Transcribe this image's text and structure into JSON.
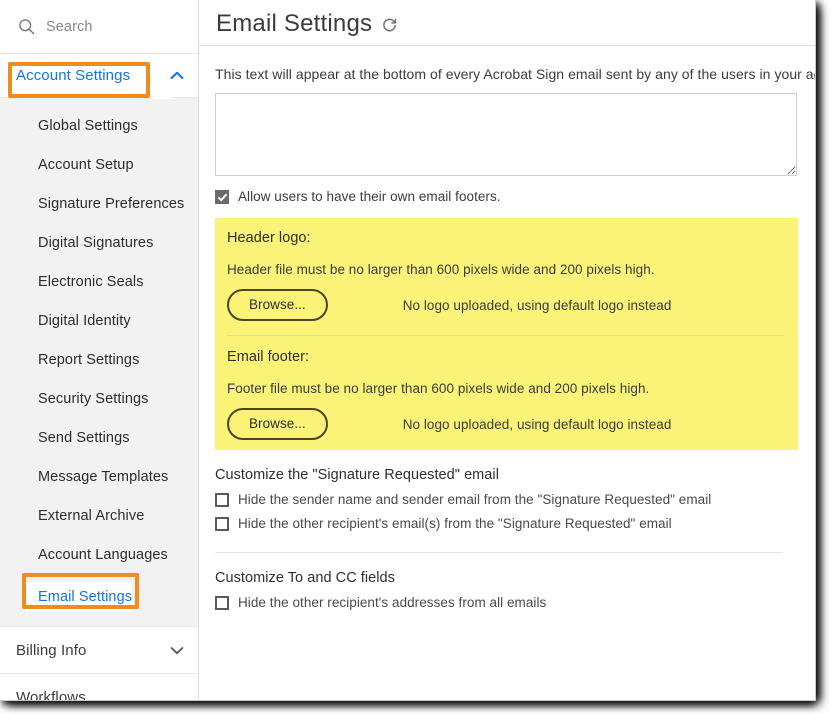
{
  "sidebar": {
    "search": {
      "placeholder": "Search",
      "icon": "search-icon"
    },
    "account_settings": {
      "label": "Account Settings",
      "chevron": "chevron-up-icon",
      "expanded": true,
      "highlight_color": "#f08b1d",
      "link_color": "#1473e6"
    },
    "items": [
      {
        "label": "Global Settings",
        "selected": false
      },
      {
        "label": "Account Setup",
        "selected": false
      },
      {
        "label": "Signature Preferences",
        "selected": false
      },
      {
        "label": "Digital Signatures",
        "selected": false
      },
      {
        "label": "Electronic Seals",
        "selected": false
      },
      {
        "label": "Digital Identity",
        "selected": false
      },
      {
        "label": "Report Settings",
        "selected": false
      },
      {
        "label": "Security Settings",
        "selected": false
      },
      {
        "label": "Send Settings",
        "selected": false
      },
      {
        "label": "Message Templates",
        "selected": false
      },
      {
        "label": "External Archive",
        "selected": false
      },
      {
        "label": "Account Languages",
        "selected": false
      },
      {
        "label": "Email Settings",
        "selected": true
      }
    ],
    "billing_info": {
      "label": "Billing Info",
      "chevron": "chevron-down-icon"
    },
    "workflows": {
      "label": "Workflows"
    }
  },
  "main": {
    "title": "Email Settings",
    "refresh_icon": "refresh-icon",
    "intro_text": "This text will appear at the bottom of every Acrobat Sign email sent by any of the users in your account.",
    "footer_textarea_value": "",
    "allow_own_footers": {
      "label": "Allow users to have their own email footers.",
      "checked": true
    },
    "highlight": {
      "background": "#faf378",
      "header_logo": {
        "heading": "Header logo:",
        "description": "Header file must be no larger than 600 pixels wide and 200 pixels high.",
        "browse_label": "Browse...",
        "status": "No logo uploaded, using default logo instead"
      },
      "email_footer": {
        "heading": "Email footer:",
        "description": "Footer file must be no larger than 600 pixels wide and 200 pixels high.",
        "browse_label": "Browse...",
        "status": "No logo uploaded, using default logo instead"
      }
    },
    "signature_requested": {
      "title": "Customize the \"Signature Requested\" email",
      "options": [
        {
          "label": "Hide the sender name and sender email from the \"Signature Requested\" email",
          "checked": false
        },
        {
          "label": "Hide the other recipient's email(s) from the \"Signature Requested\" email",
          "checked": false
        }
      ]
    },
    "to_cc_fields": {
      "title": "Customize To and CC fields",
      "options": [
        {
          "label": "Hide the other recipient's addresses from all emails",
          "checked": false
        }
      ]
    }
  }
}
